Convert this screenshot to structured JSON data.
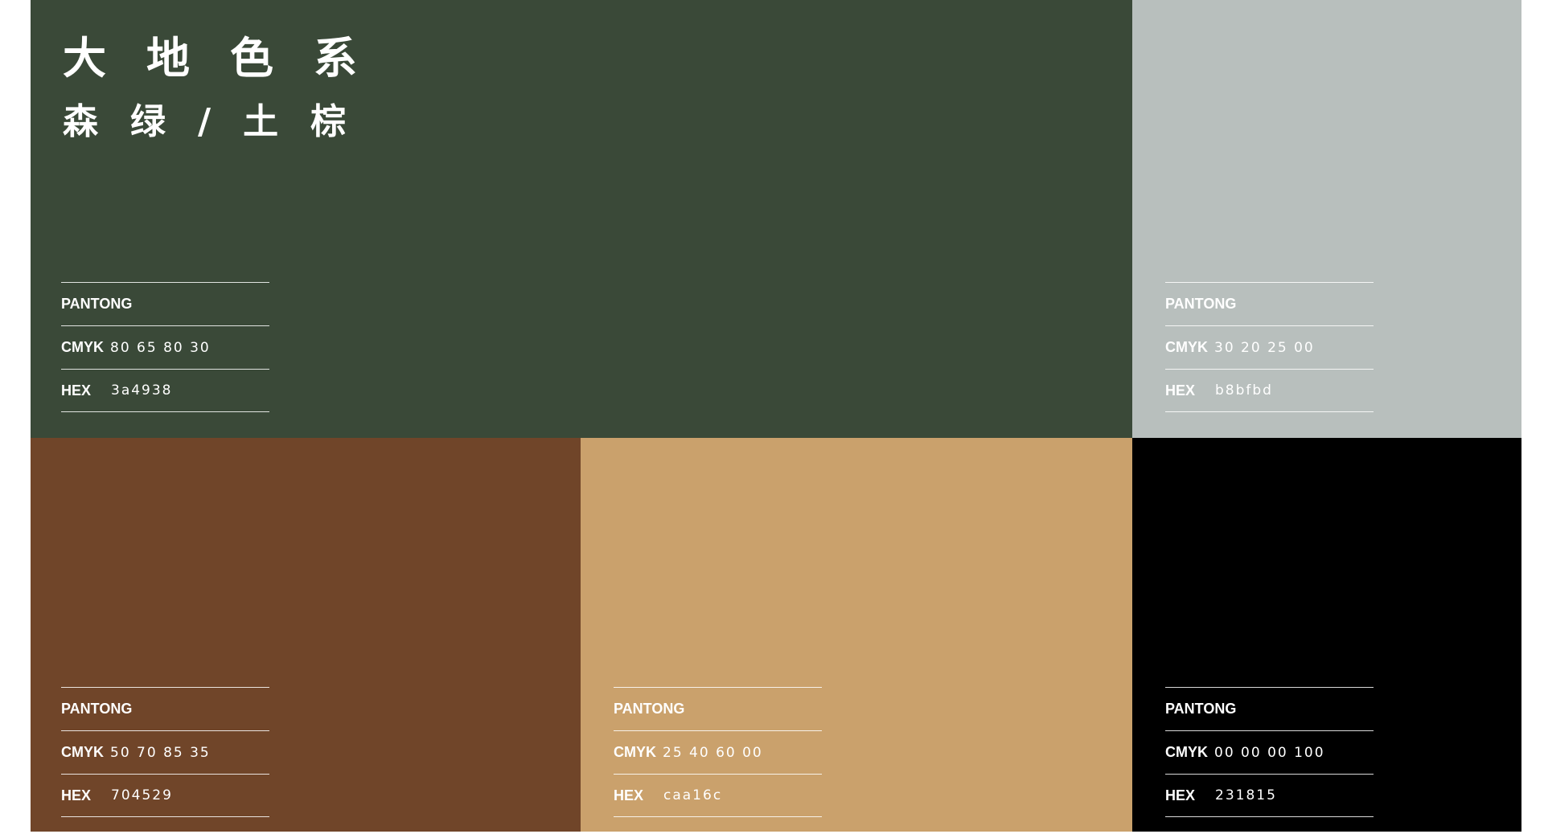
{
  "title": {
    "main": "大地色系",
    "sub": "森绿/土棕"
  },
  "swatches": [
    {
      "id": "green",
      "color": "#3a4938",
      "pantong": "PANTONG",
      "cmyk_label": "CMYK",
      "cmyk": "80 65 80 30",
      "hex_label": "HEX",
      "hex": "3a4938"
    },
    {
      "id": "grey",
      "color": "#b8bfbd",
      "pantong": "PANTONG",
      "cmyk_label": "CMYK",
      "cmyk": "30 20 25 00",
      "hex_label": "HEX",
      "hex": "b8bfbd"
    },
    {
      "id": "brown",
      "color": "#704529",
      "pantong": "PANTONG",
      "cmyk_label": "CMYK",
      "cmyk": "50 70 85 35",
      "hex_label": "HEX",
      "hex": "704529"
    },
    {
      "id": "tan",
      "color": "#caa16c",
      "pantong": "PANTONG",
      "cmyk_label": "CMYK",
      "cmyk": "25 40 60 00",
      "hex_label": "HEX",
      "hex": "caa16c"
    },
    {
      "id": "black",
      "color": "#000000",
      "pantong": "PANTONG",
      "cmyk_label": "CMYK",
      "cmyk": "00 00 00 100",
      "hex_label": "HEX",
      "hex": "231815"
    }
  ]
}
